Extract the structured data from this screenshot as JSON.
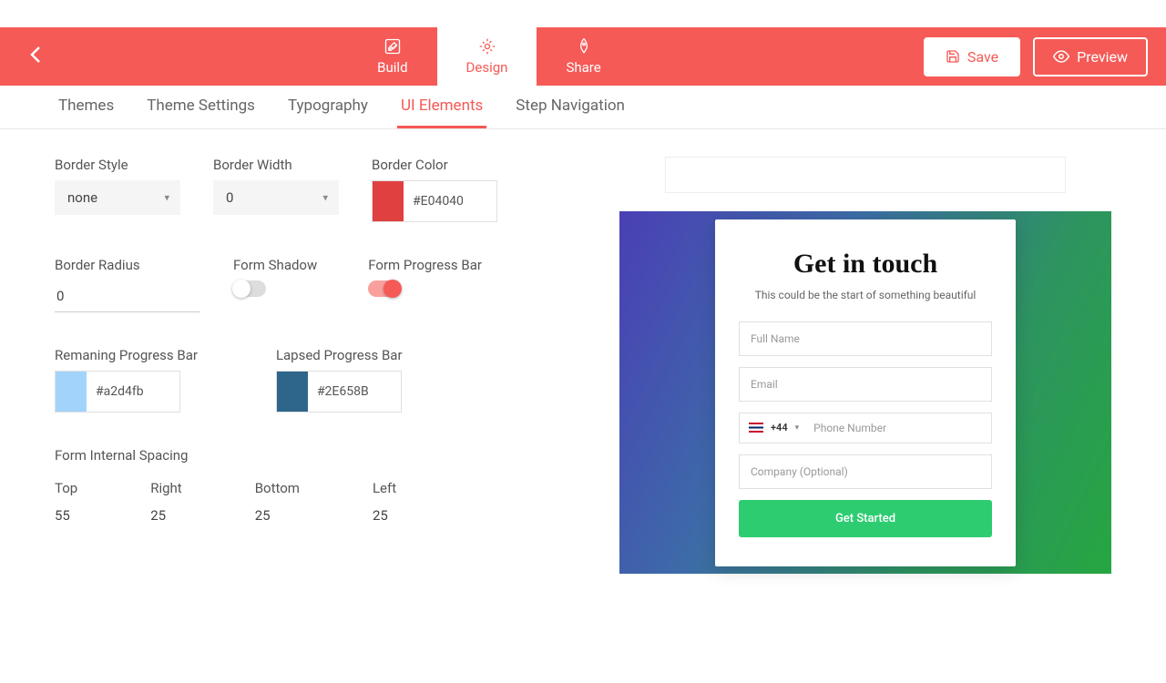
{
  "topbar": {
    "tabs": [
      {
        "label": "Build"
      },
      {
        "label": "Design"
      },
      {
        "label": "Share"
      }
    ],
    "save_label": "Save",
    "preview_label": "Preview"
  },
  "subnav": {
    "items": [
      "Themes",
      "Theme Settings",
      "Typography",
      "UI Elements",
      "Step Navigation"
    ]
  },
  "panel": {
    "border_style_label": "Border Style",
    "border_style_value": "none",
    "border_width_label": "Border Width",
    "border_width_value": "0",
    "border_color_label": "Border Color",
    "border_color_value": "#E04040",
    "border_color_swatch": "#E04040",
    "border_radius_label": "Border Radius",
    "border_radius_value": "0",
    "form_shadow_label": "Form Shadow",
    "form_shadow_on": false,
    "form_progress_label": "Form Progress Bar",
    "form_progress_on": true,
    "remaining_label": "Remaning Progress Bar",
    "remaining_value": "#a2d4fb",
    "remaining_swatch": "#a2d4fb",
    "lapsed_label": "Lapsed Progress Bar",
    "lapsed_value": "#2E658B",
    "lapsed_swatch": "#2E658B",
    "spacing_label": "Form Internal Spacing",
    "spacing": {
      "top_label": "Top",
      "top_value": "55",
      "right_label": "Right",
      "right_value": "25",
      "bottom_label": "Bottom",
      "bottom_value": "25",
      "left_label": "Left",
      "left_value": "25"
    }
  },
  "preview": {
    "title": "Get in touch",
    "subtitle": "This could be the start of something beautiful",
    "full_name_ph": "Full Name",
    "email_ph": "Email",
    "country_code": "+44",
    "phone_ph": "Phone Number",
    "company_ph": "Company (Optional)",
    "submit_label": "Get Started"
  }
}
